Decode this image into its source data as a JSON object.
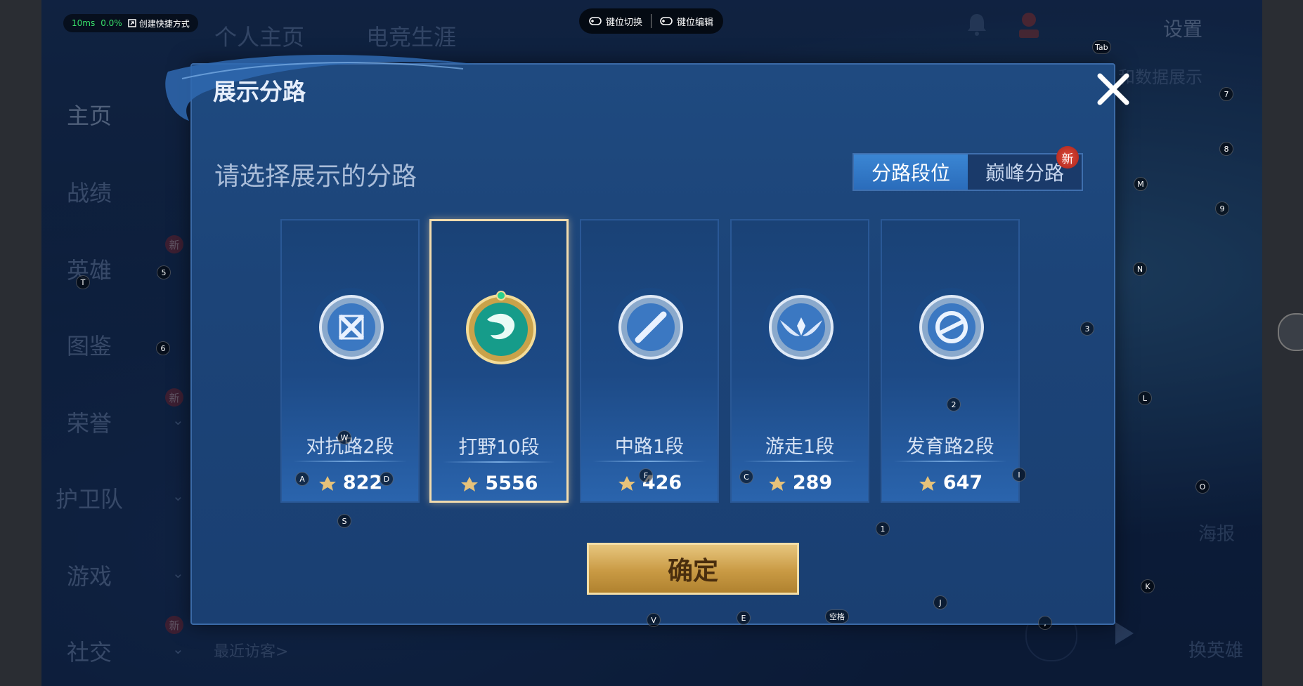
{
  "status": {
    "latency": "10ms",
    "loss": "0.0%",
    "shortcut": "创建快捷方式"
  },
  "keybar": {
    "switch": "键位切换",
    "edit": "键位编辑"
  },
  "header": {
    "tab_profile": "个人主页",
    "tab_esports": "电竞生涯",
    "settings": "设置",
    "right_text": "和数据展示"
  },
  "sidebar": {
    "items": [
      {
        "label": "主页"
      },
      {
        "label": "战绩"
      },
      {
        "label": "英雄"
      },
      {
        "label": "图鉴"
      },
      {
        "label": "荣誉"
      },
      {
        "label": "护卫队"
      },
      {
        "label": "游戏"
      },
      {
        "label": "社交"
      }
    ],
    "new_tag": "新",
    "recent_visitors": "最近访客>"
  },
  "bottom_right": {
    "poster": "海报",
    "swap_hero": "换英雄"
  },
  "modal": {
    "title": "展示分路",
    "subtitle": "请选择展示的分路",
    "segment": {
      "options": [
        "分路段位",
        "巅峰分路"
      ],
      "selected": 0,
      "new_badge": "新"
    },
    "lanes": [
      {
        "name": "对抗路2段",
        "score": "822",
        "icon": "sword-shield-icon"
      },
      {
        "name": "打野10段",
        "score": "5556",
        "icon": "dragon-icon"
      },
      {
        "name": "中路1段",
        "score": "426",
        "icon": "staff-icon"
      },
      {
        "name": "游走1段",
        "score": "289",
        "icon": "wings-icon"
      },
      {
        "name": "发育路2段",
        "score": "647",
        "icon": "bow-icon"
      }
    ],
    "selected_lane": 1,
    "confirm": "确定"
  },
  "key_hints": {
    "tab": "Tab",
    "k7": "7",
    "k8": "8",
    "k9": "9",
    "M": "M",
    "N": "N",
    "k3": "3",
    "L": "L",
    "O": "O",
    "K": "K",
    "k5": "5",
    "T": "T",
    "k6": "6",
    "W": "W",
    "A": "A",
    "D": "D",
    "F": "F",
    "C": "C",
    "I": "I",
    "k2": "2",
    "S": "S",
    "k1": "1",
    "J": "J",
    "V": "V",
    "E": "E",
    "space": "空格",
    "comma": ","
  },
  "colors": {
    "accent_blue": "#2a6cbb",
    "confirm_gold": "#c99a44",
    "selected_border": "#f2dcae"
  }
}
